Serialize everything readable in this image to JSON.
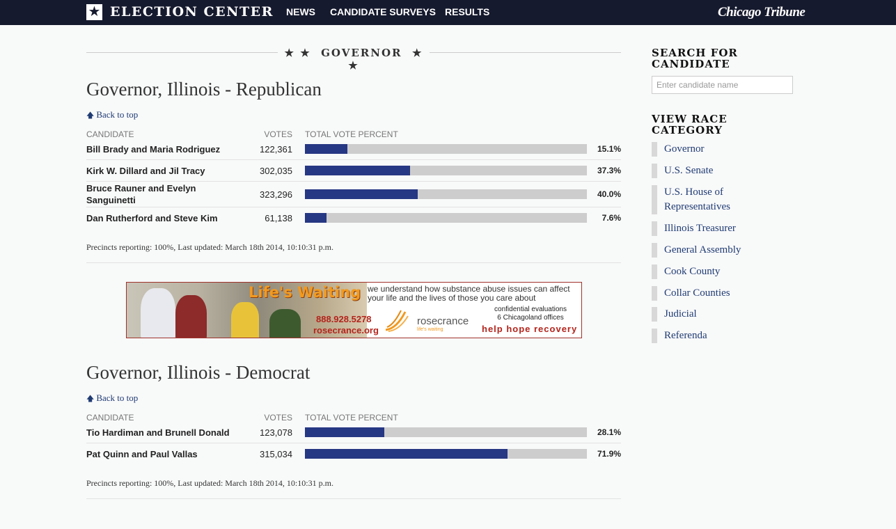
{
  "nav": {
    "logo_text": "ELECTION CENTER",
    "links": [
      "NEWS",
      "CANDIDATE SURVEYS",
      "RESULTS"
    ],
    "brand": "Chicago Tribune"
  },
  "section": {
    "title": "GOVERNOR"
  },
  "columns": {
    "candidate": "CANDIDATE",
    "votes": "VOTES",
    "percent": "TOTAL VOTE PERCENT"
  },
  "back_to_top": "Back to top",
  "races": [
    {
      "title": "Governor, Illinois - Republican",
      "rows": [
        {
          "candidate": "Bill Brady and Maria Rodriguez",
          "votes": "122,361",
          "percent": "15.1%",
          "pct_value": 15.1
        },
        {
          "candidate": "Kirk W. Dillard and Jil Tracy",
          "votes": "302,035",
          "percent": "37.3%",
          "pct_value": 37.3
        },
        {
          "candidate": "Bruce Rauner and Evelyn Sanguinetti",
          "votes": "323,296",
          "percent": "40.0%",
          "pct_value": 40.0
        },
        {
          "candidate": "Dan Rutherford and Steve Kim",
          "votes": "61,138",
          "percent": "7.6%",
          "pct_value": 7.6
        }
      ],
      "precincts": "Precincts reporting: 100%, Last updated: March 18th 2014, 10:10:31 p.m."
    },
    {
      "title": "Governor, Illinois - Democrat",
      "rows": [
        {
          "candidate": "Tio Hardiman and Brunell Donald",
          "votes": "123,078",
          "percent": "28.1%",
          "pct_value": 28.1
        },
        {
          "candidate": "Pat Quinn and Paul Vallas",
          "votes": "315,034",
          "percent": "71.9%",
          "pct_value": 71.9
        }
      ],
      "precincts": "Precincts reporting: 100%, Last updated: March 18th 2014, 10:10:31 p.m."
    }
  ],
  "ad": {
    "headline": "Life's Waiting",
    "copy": "we understand how substance abuse issues can affect your life and the lives of those you care about",
    "confidential": "confidential evaluations",
    "offices": "6 Chicagoland offices",
    "phone": "888.928.5278",
    "url": "rosecrance.org",
    "brand": "rosecrance",
    "tagline": "life's waiting",
    "slogan": "help  hope  recovery"
  },
  "sidebar": {
    "search_title": "SEARCH FOR CANDIDATE",
    "search_placeholder": "Enter candidate name",
    "category_title": "VIEW RACE CATEGORY",
    "categories": [
      "Governor",
      "U.S. Senate",
      "U.S. House of Representatives",
      "Illinois Treasurer",
      "General Assembly",
      "Cook County",
      "Collar Counties",
      "Judicial",
      "Referenda"
    ]
  },
  "colors": {
    "nav_bg": "#161a2e",
    "bar_fill": "#263783",
    "bar_bg": "#cdcdcd",
    "link": "#1f3b73"
  }
}
